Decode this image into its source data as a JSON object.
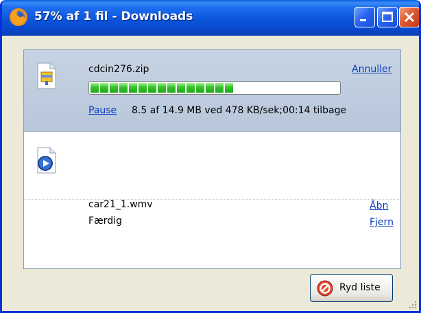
{
  "window": {
    "title": "57% af 1 fil - Downloads"
  },
  "downloads": [
    {
      "filename": "cdcin276.zip",
      "action_label": "Annuller",
      "pause_label": "Pause",
      "status": "8.5 af 14.9 MB ved 478 KB/sek;00:14 tilbage",
      "progress_percent": 57,
      "icon": "zip-file-icon"
    },
    {
      "filename": "car21_1.wmv",
      "status": "Færdig",
      "open_label": "Åbn",
      "remove_label": "Fjern",
      "icon": "wmv-file-icon"
    }
  ],
  "footer": {
    "clear_button_label": "Ryd liste"
  },
  "colors": {
    "titlebar": "#0a55dc",
    "link": "#0a3cc0",
    "progress": "#22a81a",
    "active_row": "#c6d3e3"
  }
}
